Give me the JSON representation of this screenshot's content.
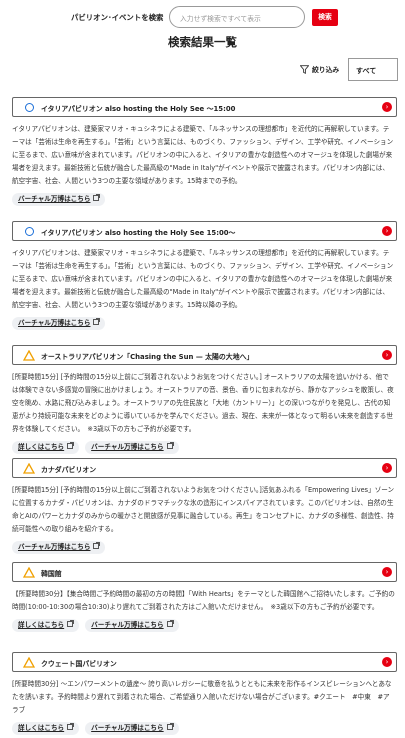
{
  "search": {
    "label": "パビリオン･イベントを検索",
    "placeholder": "入力せず検索ですべて表示",
    "button": "検索"
  },
  "results_title": "検索結果一覧",
  "filter": {
    "label": "絞り込み",
    "icon": "filter-icon"
  },
  "sort": {
    "selected": "すべて"
  },
  "colors": {
    "accent": "#e60012",
    "circle": "#1b6fd8",
    "triangle": "#f0a000"
  },
  "cards": [
    {
      "icon": "circle-icon",
      "title": "イタリアパビリオン also hosting the Holy See 〜15:00",
      "desc": "イタリアパビリオンは、建築家マリオ・キュシネラによる建築で、「ルネッサンスの理想都市」を近代的に再解釈しています。テーマは「芸術は生命を再生する」。「芸術」という言葉には、ものづくり、ファッション、デザイン、工学や研究、イノベーションに至るまで、広い意味が含まれています。パビリオンの中に入ると、イタリアの豊かな創造性へのオマージュを体現した劇場が来場者を迎えます。最新技術と伝統が融合した最高級の\"Made in Italy\"がイベントや展示で披露されます。パビリオン内部には、航空宇宙、社会、人間という3つの主要な領域があります。15時までの予約。",
      "links": [
        "バーチャル万博はこちら"
      ]
    },
    {
      "icon": "circle-icon",
      "title": "イタリアパビリオン also hosting the Holy See 15:00〜",
      "desc": "イタリアパビリオンは、建築家マリオ・キュシネラによる建築で、「ルネッサンスの理想都市」を近代的に再解釈しています。テーマは「芸術は生命を再生する」。「芸術」という言葉には、ものづくり、ファッション、デザイン、工学や研究、イノベーションに至るまで、広い意味が含まれています。パビリオンの中に入ると、イタリアの豊かな創造性へのオマージュを体現した劇場が来場者を迎えます。最新技術と伝統が融合した最高級の\"Made in Italy\"がイベントや展示で披露されます。パビリオン内部には、航空宇宙、社会、人間という3つの主要な領域があります。15時以降の予約。",
      "links": [
        "バーチャル万博はこちら"
      ]
    },
    {
      "icon": "triangle-icon",
      "title": "オーストラリアパビリオン「Chasing the Sun — 太陽の大地へ」",
      "desc": "[所要時間15分] [予約時間の15分以上前にご到着されないようお気をつけください。] オーストラリアの太陽を追いかける、他では体験できない多感覚の冒険に出かけましょう。オーストラリアの音、景色、香りに包まれながら、静かなアッシュを散策し、夜空を眺め、水路に飛び込みましょう。オーストラリアの先住民族と「大地（カントリー）」との深いつながりを発見し、古代の知恵がより持続可能な未来をどのように導いているかを学んでください。過去、現在、未来が一体となって明るい未来を創造する世界を体験してください。　※3歳以下の方もご予約が必要です。",
      "links": [
        "詳しくはこちら",
        "バーチャル万博はこちら"
      ]
    },
    {
      "icon": "triangle-icon",
      "title": "カナダパビリオン",
      "desc": "[所要時間15分] [予約時間の15分以上前にご到着されないようお気をつけください。]活気あふれる「Empowering Lives」ゾーンに位置するカナダ・パビリオンは、カナダのドラマチックな氷の造形にインスパイアされています。このパビリオンは、自然の生命とAIのパワーとカナダのみからの暖かさと開放感が見事に融合している。再生」をコンセプトに、カナダの多様性、創造性、持続可能性への取り組みを紹介する。",
      "links": [
        "バーチャル万博はこちら"
      ]
    },
    {
      "icon": "triangle-icon",
      "title": "韓国館",
      "desc": "【所要時間30分】【集合時間ご予約時間の最初の方の時間】「With Hearts」をテーマとした韓国館へご招待いたします。ご予約の時間(10:00-10:30の場合10:30)より遅れてご到着された方はご入館いただけません。　※3歳以下の方もご予約が必要です。",
      "links": [
        "詳しくはこちら",
        "バーチャル万博はこちら"
      ]
    },
    {
      "icon": "triangle-icon",
      "title": "クウェート国パビリオン",
      "desc": "[所要時間30分] 〜エンパワーメントの遺産〜 誇り高いレガシーに敬意を払うとともに未来を形作るインスピレーションへとあなたを誘います。予約時間より遅れて到着された場合、ご希望通り入館いただけない場合がございます。#クエート　#中東　#アラブ",
      "links": [
        "詳しくはこちら",
        "バーチャル万博はこちら"
      ]
    }
  ]
}
